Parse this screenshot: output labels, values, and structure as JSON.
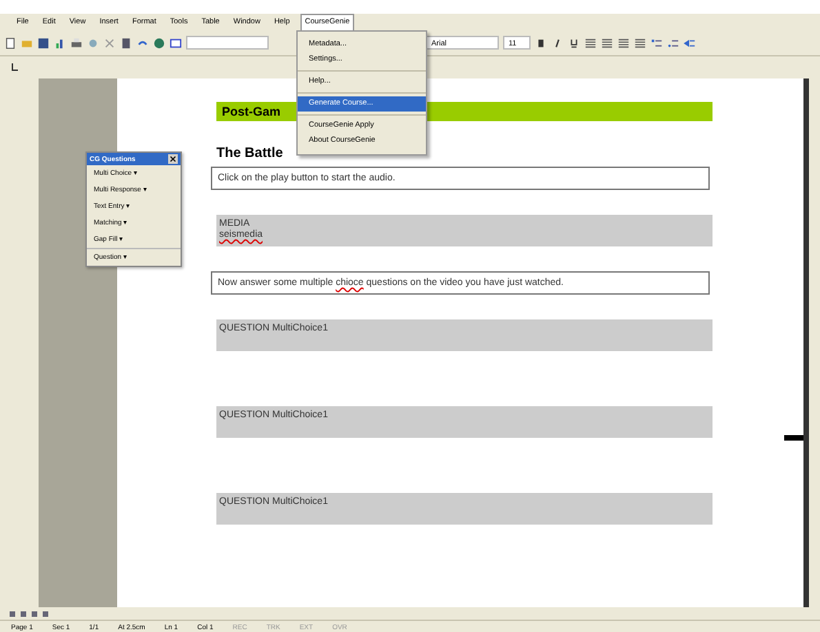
{
  "menu_bar": [
    {
      "label": "File",
      "selected": false
    },
    {
      "label": "Edit",
      "selected": false
    },
    {
      "label": "View",
      "selected": false
    },
    {
      "label": "Insert",
      "selected": false
    },
    {
      "label": "Format",
      "selected": false
    },
    {
      "label": "Tools",
      "selected": false
    },
    {
      "label": "Table",
      "selected": false
    },
    {
      "label": "Window",
      "selected": false
    },
    {
      "label": "Help",
      "selected": false
    },
    {
      "label": "CourseGenie",
      "selected": true
    }
  ],
  "toolbar": {
    "font": "Arial",
    "size": "11"
  },
  "dropdown": {
    "groups": [
      [
        {
          "label": "Metadata...",
          "selected": false
        },
        {
          "label": "Settings...",
          "selected": false
        }
      ],
      [
        {
          "label": "Help...",
          "selected": false
        }
      ],
      [
        {
          "label": "Generate Course...",
          "selected": true
        }
      ],
      [
        {
          "label": "CourseGenie Apply",
          "selected": false
        },
        {
          "label": "About CourseGenie",
          "selected": false
        }
      ]
    ]
  },
  "question_toolbar": {
    "title": "CG Questions",
    "items": [
      "Multi Choice ▾",
      "Multi Response ▾",
      "Text Entry ▾",
      "Matching ▾",
      "Gap Fill ▾",
      "Question ▾"
    ]
  },
  "document": [
    {
      "kind": "heading_bar",
      "text": "Post-Gam"
    },
    {
      "kind": "heading",
      "text": "The Battle"
    },
    {
      "kind": "textbox",
      "segments": [
        {
          "text": "Click on the play button to start the audio.",
          "misspelled": false
        }
      ]
    },
    {
      "kind": "shaded",
      "lines": [
        {
          "text": "MEDIA",
          "misspelled": false
        },
        {
          "text": "seismedia",
          "misspelled": true
        }
      ]
    },
    {
      "kind": "textbox",
      "segments": [
        {
          "text": "Now answer some multiple ",
          "misspelled": false
        },
        {
          "text": "chioce",
          "misspelled": true
        },
        {
          "text": " questions on the video you have just watched.",
          "misspelled": false
        }
      ]
    },
    {
      "kind": "shaded",
      "lines": [
        {
          "text": "QUESTION MultiChoice1",
          "misspelled": false
        }
      ]
    },
    {
      "kind": "shaded",
      "lines": [
        {
          "text": "QUESTION MultiChoice1",
          "misspelled": false
        }
      ]
    },
    {
      "kind": "shaded",
      "lines": [
        {
          "text": "QUESTION MultiChoice1",
          "misspelled": false
        }
      ]
    }
  ],
  "status_bar": [
    "Page 1",
    "Sec 1",
    "1/1",
    "At 2.5cm",
    "Ln 1",
    "Col 1",
    "REC",
    "TRK",
    "EXT",
    "OVR"
  ]
}
